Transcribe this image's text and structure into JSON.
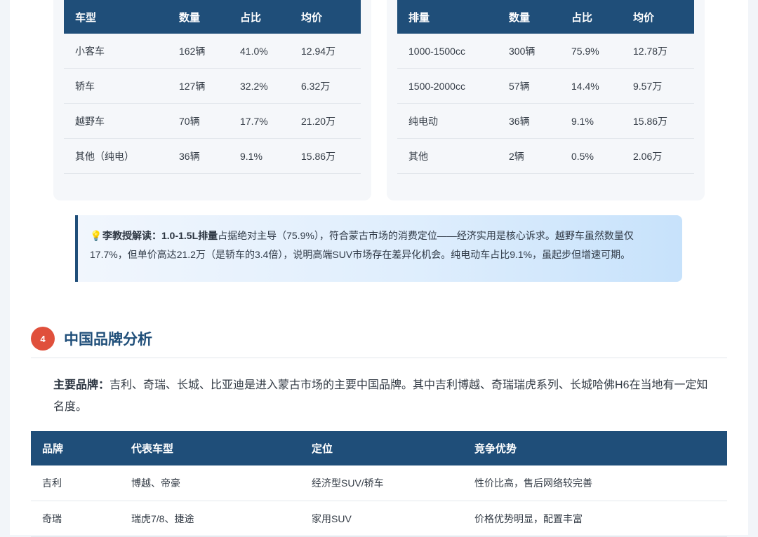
{
  "table_body_type": {
    "headers": [
      "车型",
      "数量",
      "占比",
      "均价"
    ],
    "rows": [
      [
        "小客车",
        "162辆",
        "41.0%",
        "12.94万"
      ],
      [
        "轿车",
        "127辆",
        "32.2%",
        "6.32万"
      ],
      [
        "越野车",
        "70辆",
        "17.7%",
        "21.20万"
      ],
      [
        "其他（纯电）",
        "36辆",
        "9.1%",
        "15.86万"
      ]
    ]
  },
  "table_displacement": {
    "headers": [
      "排量",
      "数量",
      "占比",
      "均价"
    ],
    "rows": [
      [
        "1000-1500cc",
        "300辆",
        "75.9%",
        "12.78万"
      ],
      [
        "1500-2000cc",
        "57辆",
        "14.4%",
        "9.57万"
      ],
      [
        "纯电动",
        "36辆",
        "9.1%",
        "15.86万"
      ],
      [
        "其他",
        "2辆",
        "0.5%",
        "2.06万"
      ]
    ]
  },
  "callout": {
    "icon": "lightbulb-icon",
    "icon_glyph": "💡",
    "lead": "李教授解读：1.0-1.5L排量",
    "text": "占据绝对主导（75.9%），符合蒙古市场的消费定位——经济实用是核心诉求。越野车虽然数量仅17.7%，但单价高达21.2万（是轿车的3.4倍），说明高端SUV市场存在差异化机会。纯电动车占比9.1%，虽起步但增速可期。"
  },
  "section4": {
    "number": "4",
    "title": "中国品牌分析"
  },
  "intro": {
    "lead": "主要品牌：",
    "text": "吉利、奇瑞、长城、比亚迪是进入蒙古市场的主要中国品牌。其中吉利博越、奇瑞瑞虎系列、长城哈佛H6在当地有一定知名度。"
  },
  "brand_table": {
    "headers": [
      "品牌",
      "代表车型",
      "定位",
      "竞争优势"
    ],
    "rows": [
      [
        "吉利",
        "博越、帝豪",
        "经济型SUV/轿车",
        "性价比高，售后网络较完善"
      ],
      [
        "奇瑞",
        "瑞虎7/8、捷途",
        "家用SUV",
        "价格优势明显，配置丰富"
      ]
    ]
  },
  "colors": {
    "header_bg": "#1f4e79",
    "accent_red": "#e0503c",
    "callout_bg": "#dfeefd"
  }
}
